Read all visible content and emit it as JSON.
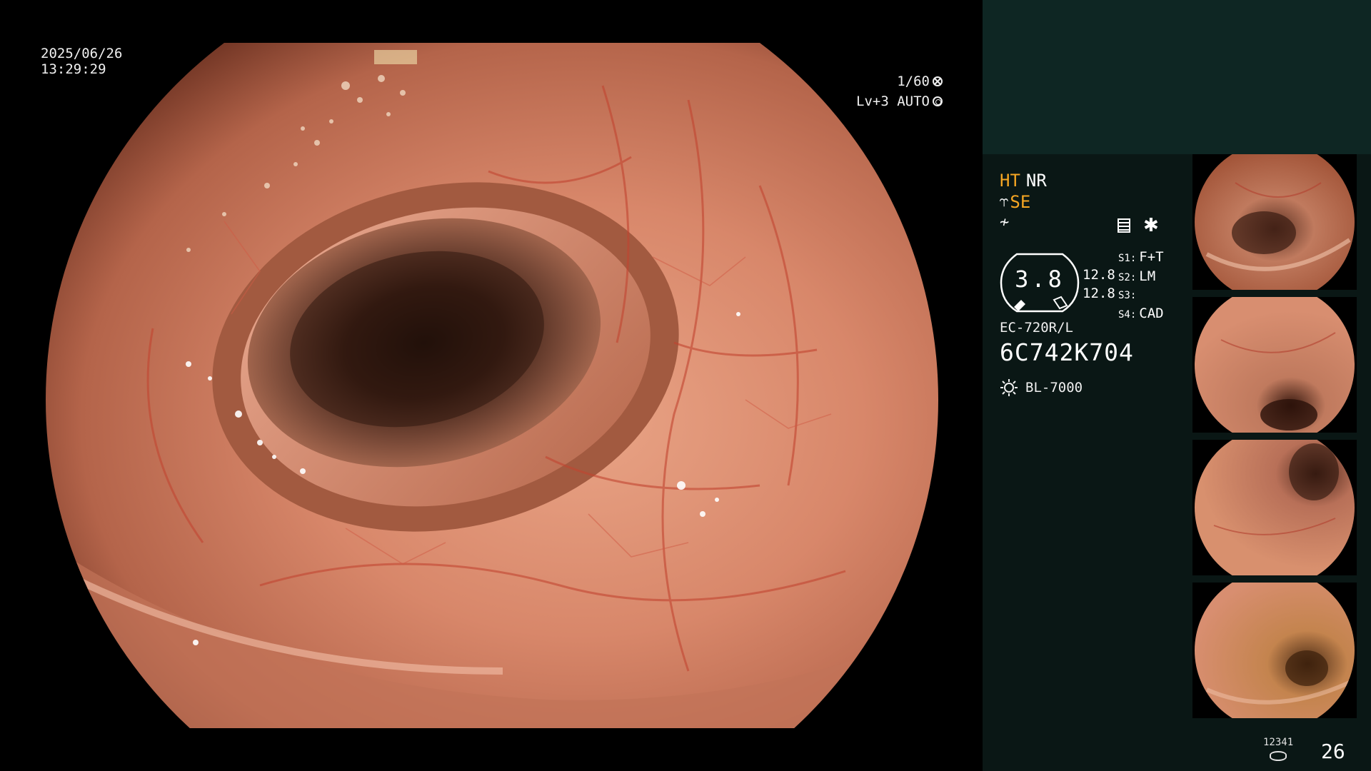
{
  "overlay": {
    "date": "2025/06/26",
    "time": "13:29:29",
    "shutter": "1/60",
    "level_auto": "Lv+3 AUTO"
  },
  "panel": {
    "ht": "HT",
    "nr": "NR",
    "se": "SE",
    "gauge_value": "3.8",
    "gauge_num_top": "12.8",
    "gauge_num_bottom": "12.8",
    "settings": [
      {
        "key": "S1:",
        "value": "F+T"
      },
      {
        "key": "S2:",
        "value": "LM"
      },
      {
        "key": "S3:",
        "value": ""
      },
      {
        "key": "S4:",
        "value": "CAD"
      }
    ],
    "scope_model": "EC-720R/L",
    "scope_serial": "6C742K704",
    "light_source": "BL-7000"
  },
  "footer": {
    "image_count": "12341",
    "frame_number": "26"
  },
  "icons": {
    "aperture": "aperture-icon",
    "auto": "auto-exposure-icon",
    "enhancement": "enhancement-icon",
    "filter": "filter-icon",
    "document": "document-icon",
    "asterisk": "asterisk-icon",
    "light": "light-icon",
    "disk": "disk-icon"
  },
  "colors": {
    "accent_orange": "#f5a623",
    "panel_bg": "#0a1715",
    "panel_top_bg": "#0e2623"
  }
}
